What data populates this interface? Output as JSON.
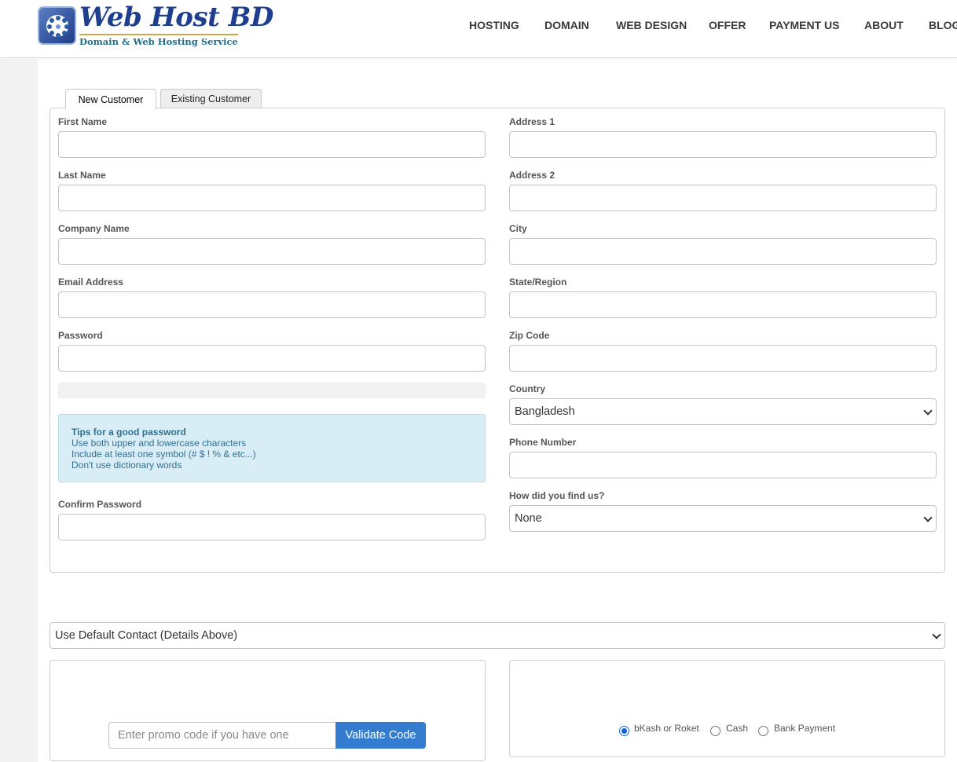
{
  "brand": {
    "title": "Web Host BD",
    "subtitle": "Domain & Web Hosting Service"
  },
  "nav": {
    "items": [
      "HOSTING",
      "DOMAIN",
      "WEB DESIGN",
      "OFFER",
      "PAYMENT US",
      "ABOUT",
      "BLOG"
    ]
  },
  "tabs": {
    "new_customer": "New Customer",
    "existing_customer": "Existing Customer"
  },
  "form": {
    "left": {
      "first_name": "First Name",
      "last_name": "Last Name",
      "company_name": "Company Name",
      "email": "Email Address",
      "password": "Password",
      "confirm_password": "Confirm Password"
    },
    "right": {
      "address1": "Address 1",
      "address2": "Address 2",
      "city": "City",
      "state": "State/Region",
      "zip": "Zip Code",
      "country": "Country",
      "country_value": "Bangladesh",
      "phone": "Phone Number",
      "find_us": "How did you find us?",
      "find_us_value": "None"
    },
    "tips": {
      "title": "Tips for a good password",
      "line1": "Use both upper and lowercase characters",
      "line2": "Include at least one symbol (# $ ! % & etc...)",
      "line3": "Don't use dictionary words"
    }
  },
  "contact": {
    "value": "Use Default Contact (Details Above)"
  },
  "promo": {
    "placeholder": "Enter promo code if you have one",
    "button": "Validate Code"
  },
  "payment": {
    "options": [
      {
        "label": "bKash or Roket",
        "checked": true
      },
      {
        "label": "Cash",
        "checked": false
      },
      {
        "label": "Bank Payment",
        "checked": false
      }
    ]
  },
  "colors": {
    "brand_blue": "#1f3f8e",
    "button_blue": "#337ccf",
    "tips_bg": "#d9edf6",
    "tips_text": "#31708f"
  }
}
